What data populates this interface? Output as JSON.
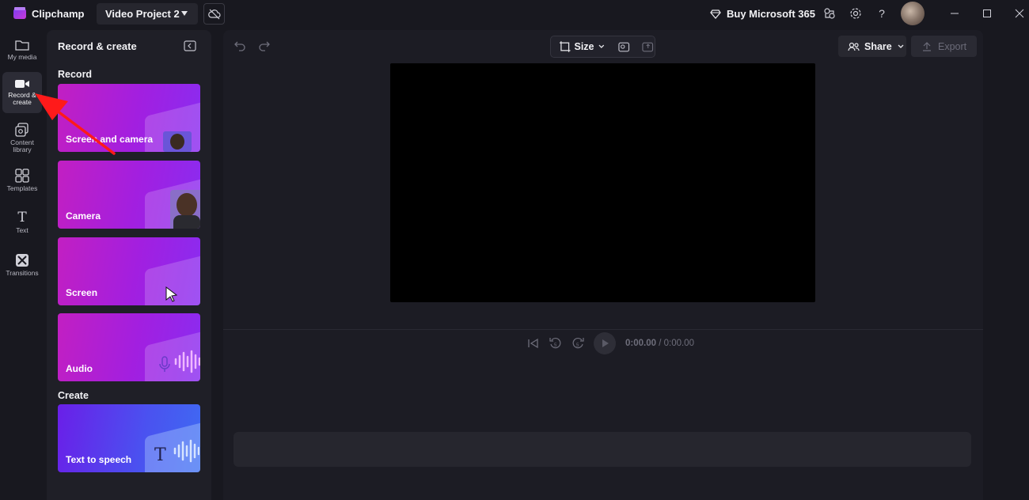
{
  "app": {
    "name": "Clipchamp",
    "project_name": "Video Project 2"
  },
  "titlebar": {
    "buy_label": "Buy Microsoft 365"
  },
  "nav": {
    "items": [
      {
        "label": "My media"
      },
      {
        "label": "Record & create"
      },
      {
        "label": "Content library"
      },
      {
        "label": "Templates"
      },
      {
        "label": "Text"
      },
      {
        "label": "Transitions"
      }
    ]
  },
  "panel": {
    "title": "Record & create",
    "record_header": "Record",
    "create_header": "Create",
    "cards": [
      {
        "label": "Screen and camera"
      },
      {
        "label": "Camera"
      },
      {
        "label": "Screen"
      },
      {
        "label": "Audio"
      },
      {
        "label": "Text to speech"
      }
    ]
  },
  "toolbar": {
    "size_label": "Size",
    "share_label": "Share",
    "export_label": "Export"
  },
  "playback": {
    "current_time": "0:00.00",
    "total_time": "0:00.00"
  },
  "colors": {
    "accent": "#c21fc2",
    "annotation_arrow": "#ff1a1a"
  }
}
